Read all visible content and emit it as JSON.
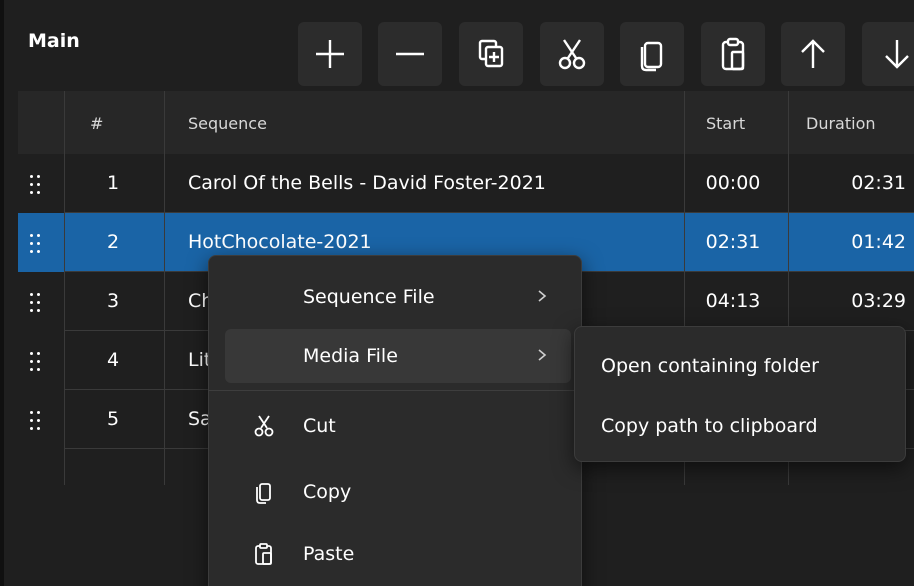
{
  "panel": {
    "title": "Main"
  },
  "toolbar": {
    "buttons": [
      {
        "icon": "plus-icon"
      },
      {
        "icon": "minus-icon"
      },
      {
        "icon": "duplicate-icon"
      },
      {
        "icon": "cut-icon"
      },
      {
        "icon": "copy-icon"
      },
      {
        "icon": "paste-icon"
      },
      {
        "icon": "arrow-up-icon"
      },
      {
        "icon": "arrow-down-icon"
      }
    ]
  },
  "table": {
    "columns": [
      "#",
      "Sequence",
      "Start",
      "Duration"
    ],
    "rows": [
      {
        "num": "1",
        "sequence": "Carol Of the Bells - David Foster-2021",
        "start": "00:00",
        "duration": "02:31",
        "selected": false
      },
      {
        "num": "2",
        "sequence": "HotChocolate-2021",
        "start": "02:31",
        "duration": "01:42",
        "selected": true
      },
      {
        "num": "3",
        "sequence": "Ch",
        "start": "04:13",
        "duration": "03:29",
        "selected": false
      },
      {
        "num": "4",
        "sequence": "Lit",
        "start": "",
        "duration": "",
        "selected": false
      },
      {
        "num": "5",
        "sequence": "Sa",
        "start": "",
        "duration": "",
        "selected": false
      }
    ]
  },
  "context_menu": {
    "items": [
      {
        "label": "Sequence File",
        "submenu": true
      },
      {
        "label": "Media File",
        "submenu": true,
        "hovered": true
      },
      {
        "label": "Cut",
        "icon": "cut-icon"
      },
      {
        "label": "Copy",
        "icon": "copy-icon"
      },
      {
        "label": "Paste",
        "icon": "paste-icon"
      }
    ],
    "submenu_items": [
      "Open containing folder",
      "Copy path to clipboard"
    ]
  },
  "colors": {
    "background": "#1f1f1f",
    "header": "#272727",
    "selection": "#1a64a6",
    "menu": "#2b2b2b"
  }
}
